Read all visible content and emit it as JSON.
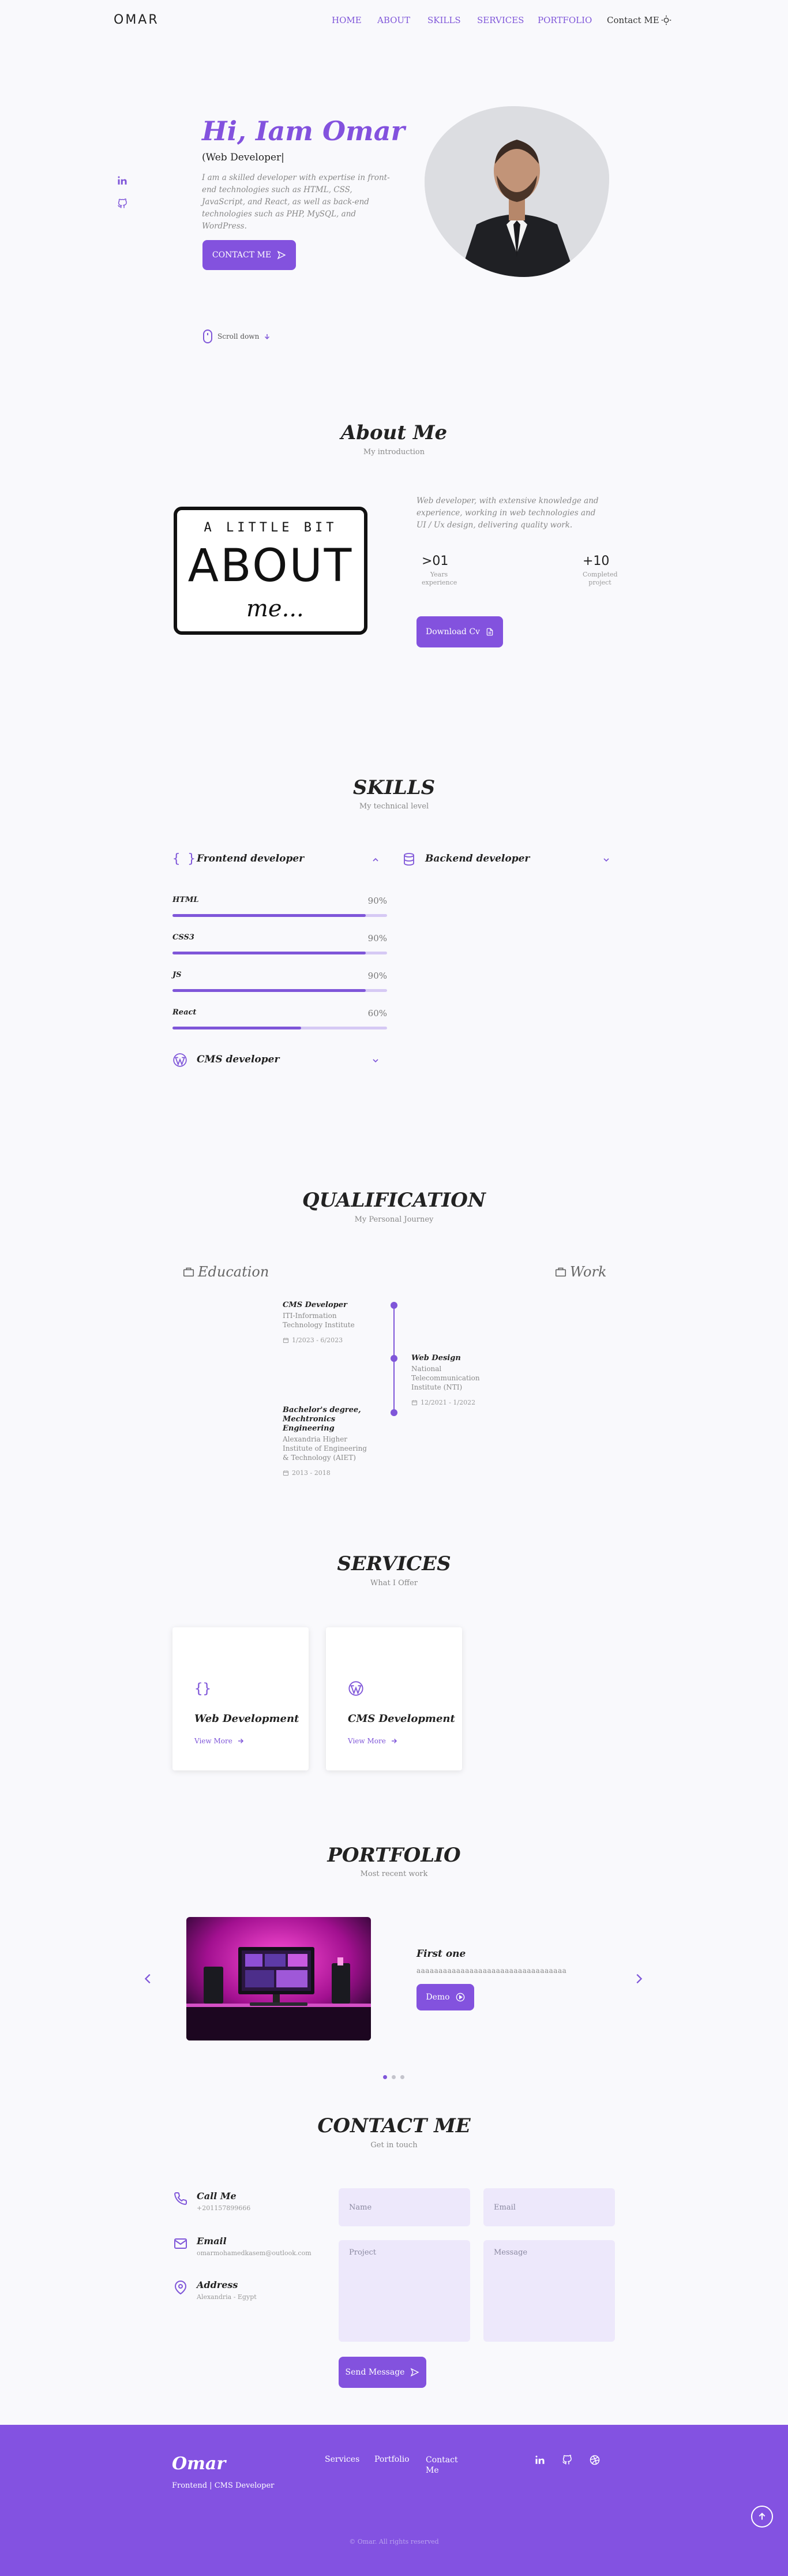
{
  "nav": {
    "logo": "OMAR",
    "links": [
      "HOME",
      "ABOUT",
      "SKILLS",
      "SERVICES",
      "PORTFOLIO",
      "Contact ME"
    ]
  },
  "hero": {
    "title": "Hi, Iam Omar",
    "role": "Web Developer",
    "description": "I am a skilled developer with expertise in front-end technologies such as HTML, CSS, JavaScript, and React, as well as back-end technologies such as PHP, MySQL, and WordPress.",
    "contact_button": "CONTACT ME",
    "scroll_label": "Scroll down"
  },
  "about": {
    "title": "About Me",
    "subtitle": "My introduction",
    "image_line1": "A LITTLE BIT",
    "image_line2": "ABOUT",
    "image_line3": "me...",
    "description": "Web developer, with extensive knowledge and experience, working in web technologies and UI / Ux design, delivering quality work.",
    "stats": [
      {
        "value": ">01",
        "label": "Years experience"
      },
      {
        "value": "+10",
        "label": "Completed project"
      }
    ],
    "download_button": "Download Cv"
  },
  "skills": {
    "title": "SKILLS",
    "subtitle": "My technical level",
    "groups": [
      {
        "name": "Frontend developer",
        "expanded": true
      },
      {
        "name": "Backend developer",
        "expanded": false
      },
      {
        "name": "CMS developer",
        "expanded": false
      }
    ],
    "items": [
      {
        "name": "HTML",
        "percent_label": "90%",
        "level": 0.9
      },
      {
        "name": "CSS3",
        "percent_label": "90%",
        "level": 0.9
      },
      {
        "name": "JS",
        "percent_label": "90%",
        "level": 0.9
      },
      {
        "name": "React",
        "percent_label": "60%",
        "level": 0.6
      }
    ]
  },
  "qualification": {
    "title": "QUALIFICATION",
    "subtitle": "My Personal Journey",
    "tab_education": "Education",
    "tab_work": "Work",
    "entries": [
      {
        "title": "CMS Developer",
        "place": "ITI-Information Technology Institute",
        "date": "1/2023 - 6/2023"
      },
      {
        "title": "Web Design",
        "place": "National Telecommunication Institute (NTI)",
        "date": "12/2021 - 1/2022"
      },
      {
        "title": "Bachelor's degree, Mechtronics Engineering",
        "place": "Alexandria Higher Institute of Engineering & Technology (AIET)",
        "date": "2013 - 2018"
      }
    ]
  },
  "services": {
    "title": "SERVICES",
    "subtitle": "What I Offer",
    "cards": [
      {
        "title": "Web Development",
        "link": "View More"
      },
      {
        "title": "CMS Development",
        "link": "View More"
      }
    ]
  },
  "portfolio": {
    "title": "PORTFOLIO",
    "subtitle": "Most recent work",
    "project_title": "First one",
    "project_desc": "aaaaaaaaaaaaaaaaaaaaaaaaaaaaaaaaaa",
    "demo_button": "Demo"
  },
  "contact": {
    "title": "CONTACT ME",
    "subtitle": "Get in touch",
    "items": [
      {
        "label": "Call Me",
        "value": "+201157899666"
      },
      {
        "label": "Email",
        "value": "omarmohamedkasem@outlook.com"
      },
      {
        "label": "Address",
        "value": "Alexandria - Egypt"
      }
    ],
    "placeholders": {
      "name": "Name",
      "email": "Email",
      "project": "Project",
      "message": "Message"
    },
    "send_button": "Send Message"
  },
  "footer": {
    "logo": "Omar",
    "tagline": "Frontend | CMS Developer",
    "links": [
      "Services",
      "Portfolio",
      "Contact Me"
    ],
    "copyright": "© Omar. All rights reserved"
  },
  "colors": {
    "accent": "#7f56d9",
    "button": "#8352de",
    "footer": "#8352e1",
    "field": "#ede8fb"
  }
}
